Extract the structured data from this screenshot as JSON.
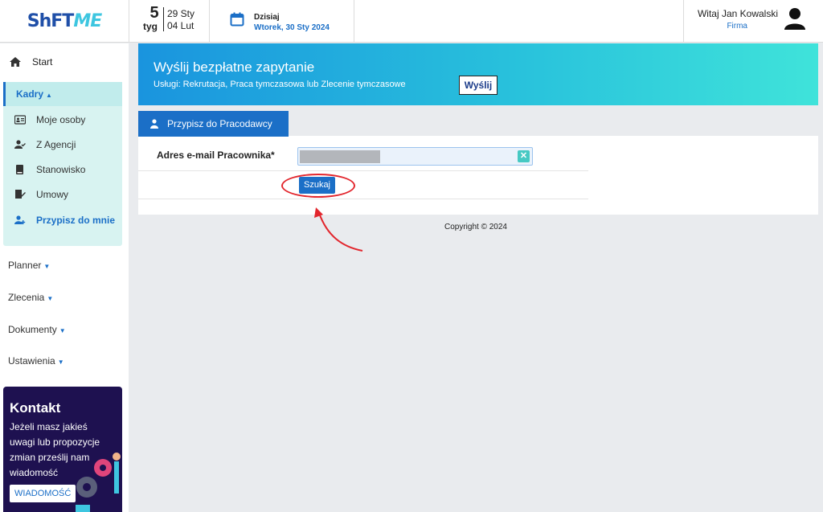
{
  "header": {
    "logo_part1": "ShFT",
    "logo_part2": "ME",
    "week_number": "5",
    "week_label": "tyg",
    "week_start": "29 Sty",
    "week_end": "04 Lut",
    "today_label": "Dzisiaj",
    "today_date": "Wtorek, 30 Sty 2024",
    "greeting": "Witaj Jan Kowalski",
    "role": "Firma"
  },
  "sidebar": {
    "start": "Start",
    "kadry": "Kadry",
    "kadry_items": [
      "Moje osoby",
      "Z Agencji",
      "Stanowisko",
      "Umowy",
      "Przypisz do mnie"
    ],
    "top_items": [
      "Planner",
      "Zlecenia",
      "Dokumenty",
      "Ustawienia"
    ],
    "contact": {
      "title": "Kontakt",
      "text": "Jeżeli masz jakieś uwagi lub propozycje zmian prześlij nam wiadomość",
      "button": "WIADOMOŚĆ"
    }
  },
  "banner": {
    "title": "Wyślij bezpłatne zapytanie",
    "subtitle": "Usługi: Rekrutacja, Praca tymczasowa lub Zlecenie tymczasowe",
    "button": "Wyślij"
  },
  "form": {
    "tab": "Przypisz do Pracodawcy",
    "email_label": "Adres e-mail Pracownika*",
    "search_button": "Szukaj"
  },
  "footer": {
    "copyright": "Copyright © 2024"
  },
  "colors": {
    "accent": "#1b6fc7",
    "annotation": "#e2262d"
  }
}
